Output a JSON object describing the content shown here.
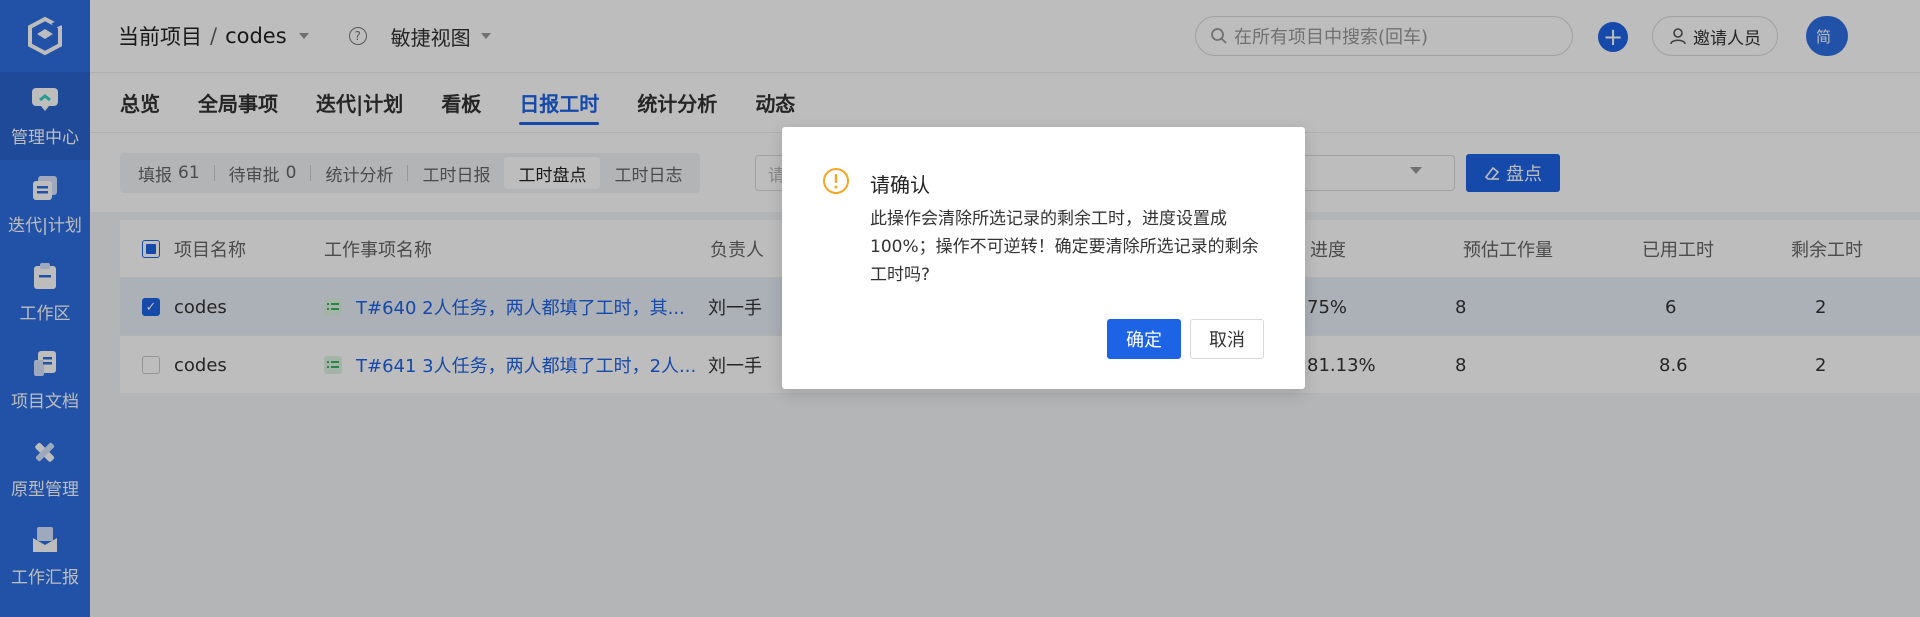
{
  "sidebar": {
    "items": [
      {
        "label": "管理中心",
        "icon": "chat-monitor-icon",
        "active": true
      },
      {
        "label": "迭代|计划",
        "icon": "layers-icon",
        "active": false
      },
      {
        "label": "工作区",
        "icon": "clipboard-icon",
        "active": false
      },
      {
        "label": "项目文档",
        "icon": "document-icon",
        "active": false
      },
      {
        "label": "原型管理",
        "icon": "ruler-pencil-icon",
        "active": false
      },
      {
        "label": "工作汇报",
        "icon": "inbox-report-icon",
        "active": false
      }
    ]
  },
  "header": {
    "project_label": "当前项目",
    "project_name": "codes",
    "view_label": "敏捷视图",
    "search_placeholder": "在所有项目中搜索(回车)",
    "invite_label": "邀请人员",
    "avatar_text": "简"
  },
  "tabs": [
    {
      "label": "总览",
      "active": false
    },
    {
      "label": "全局事项",
      "active": false
    },
    {
      "label": "迭代|计划",
      "active": false
    },
    {
      "label": "看板",
      "active": false
    },
    {
      "label": "日报工时",
      "active": true
    },
    {
      "label": "统计分析",
      "active": false
    },
    {
      "label": "动态",
      "active": false
    }
  ],
  "toolbar": {
    "segments": [
      {
        "label": "填报",
        "count": "61",
        "active": false
      },
      {
        "label": "待审批",
        "count": "0",
        "active": false
      },
      {
        "label": "统计分析",
        "count": "",
        "active": false
      },
      {
        "label": "工时日报",
        "count": "",
        "active": false
      },
      {
        "label": "工时盘点",
        "count": "",
        "active": true
      },
      {
        "label": "工时日志",
        "count": "",
        "active": false
      }
    ],
    "filter_placeholder": "请",
    "check_button": "盘点"
  },
  "table": {
    "headers": {
      "project": "项目名称",
      "task": "工作事项名称",
      "owner": "负责人",
      "progress": "进度",
      "estimate": "预估工作量",
      "used": "已用工时",
      "remaining": "剩余工时"
    },
    "rows": [
      {
        "checked": true,
        "project": "codes",
        "task": "T#640 2人任务，两人都填了工时，其...",
        "owner": "刘一手",
        "progress": "75%",
        "estimate": "8",
        "used": "6",
        "remaining": "2"
      },
      {
        "checked": false,
        "project": "codes",
        "task": "T#641 3人任务，两人都填了工时，2人...",
        "owner": "刘一手",
        "progress": "81.13%",
        "estimate": "8",
        "used": "8.6",
        "remaining": "2"
      }
    ]
  },
  "modal": {
    "title": "请确认",
    "body": "此操作会清除所选记录的剩余工时，进度设置成100%；操作不可逆转！确定要清除所选记录的剩余工时吗?",
    "ok_label": "确定",
    "cancel_label": "取消",
    "warn_color": "#f5a623"
  },
  "colors": {
    "brand": "#2f6fe3",
    "accent": "#1d63e6"
  }
}
